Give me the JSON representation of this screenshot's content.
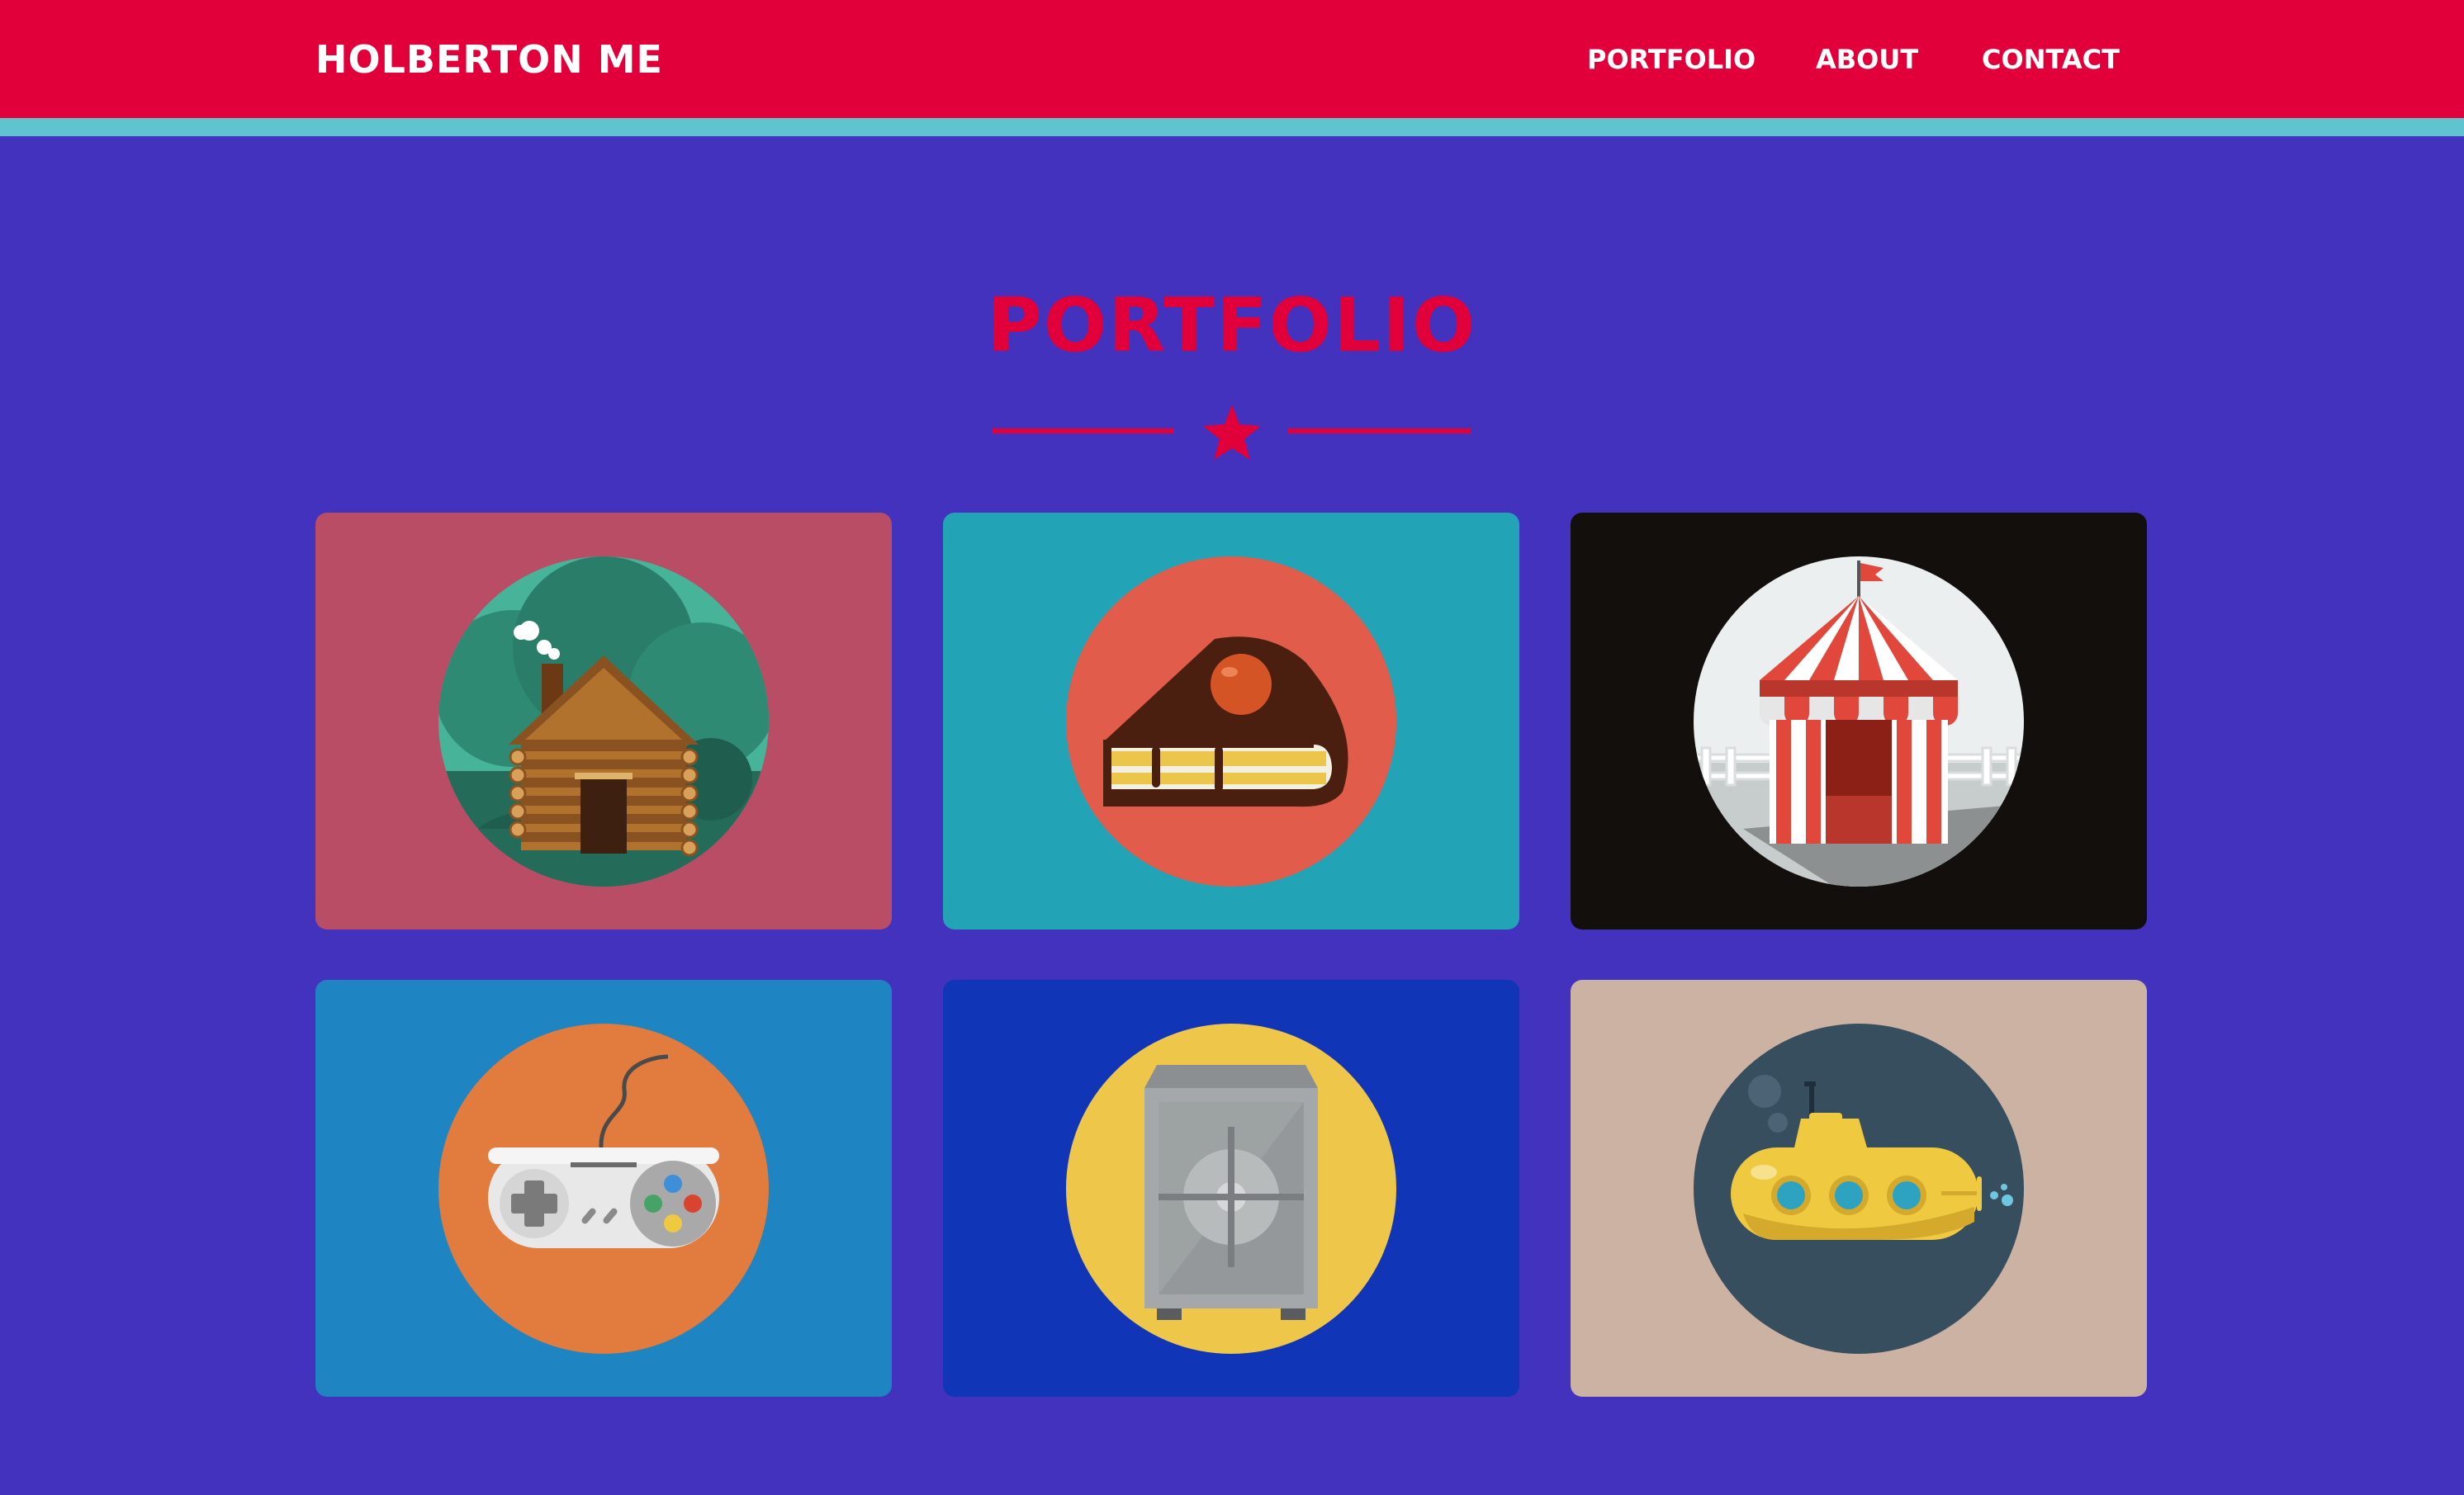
{
  "nav": {
    "brand": "HOLBERTON ME",
    "links": [
      "PORTFOLIO",
      "ABOUT",
      "CONTACT"
    ]
  },
  "section": {
    "title": "PORTFOLIO",
    "divider_icon": "star-icon"
  },
  "colors": {
    "page_background": "#4232bd",
    "nav_background": "#e2003b",
    "nav_accent": "#5fc4cf",
    "title": "#e2003b"
  },
  "portfolio": {
    "items": [
      {
        "icon": "log-cabin-icon",
        "card_color": "#b84d65",
        "circle_color": "#2f8a74"
      },
      {
        "icon": "cake-slice-icon",
        "card_color": "#22a3b6",
        "circle_color": "#e25c4b"
      },
      {
        "icon": "circus-tent-icon",
        "card_color": "#130f0d",
        "circle_color": "#eceff0"
      },
      {
        "icon": "game-controller-icon",
        "card_color": "#1e84c2",
        "circle_color": "#e27b3e"
      },
      {
        "icon": "safe-icon",
        "card_color": "#1035b6",
        "circle_color": "#eec64a"
      },
      {
        "icon": "submarine-icon",
        "card_color": "#cbb2a3",
        "circle_color": "#374e5f"
      }
    ]
  }
}
